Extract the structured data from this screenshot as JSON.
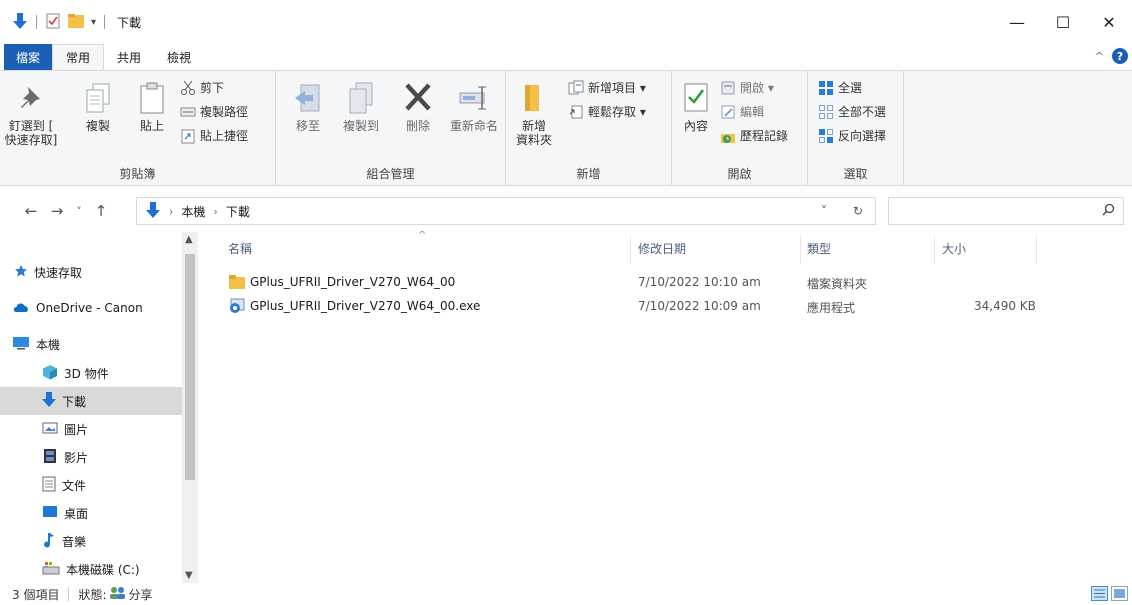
{
  "title_bar": {
    "title": "下載",
    "minimize": "—",
    "maximize": "☐",
    "close": "✕"
  },
  "tabs": {
    "file": "檔案",
    "home": "常用",
    "share": "共用",
    "view": "檢視",
    "collapse": "^",
    "help": "?"
  },
  "ribbon": {
    "clipboard": {
      "label": "剪貼簿",
      "pin_line1": "釘選到 [",
      "pin_line2": "快速存取]",
      "copy": "複製",
      "paste": "貼上",
      "cut": "剪下",
      "copy_path": "複製路徑",
      "paste_shortcut": "貼上捷徑"
    },
    "organize": {
      "label": "組合管理",
      "move_to": "移至",
      "copy_to": "複製到",
      "delete": "刪除",
      "rename": "重新命名"
    },
    "new": {
      "label": "新增",
      "new_folder_line1": "新增",
      "new_folder_line2": "資料夾",
      "new_item": "新增項目 ▾",
      "easy_access": "輕鬆存取 ▾"
    },
    "open": {
      "label": "開啟",
      "properties": "內容",
      "open": "開啟 ▾",
      "edit": "編輯",
      "history": "歷程記錄"
    },
    "select": {
      "label": "選取",
      "select_all": "全選",
      "select_none": "全部不選",
      "invert": "反向選擇"
    }
  },
  "address": {
    "back": "←",
    "forward": "→",
    "recent": "˅",
    "up": "↑",
    "crumbs": [
      "本機",
      "下載"
    ],
    "crumb_sep": "›",
    "dropdown": "˅",
    "refresh": "↻",
    "search_placeholder": ""
  },
  "sidebar": {
    "items": [
      {
        "label": "快速存取",
        "icon": "star-icon"
      },
      {
        "label": "OneDrive - Canon",
        "icon": "cloud-icon"
      },
      {
        "label": "本機",
        "icon": "pc-icon"
      },
      {
        "label": "3D 物件",
        "icon": "cube-icon"
      },
      {
        "label": "下載",
        "icon": "download-icon"
      },
      {
        "label": "圖片",
        "icon": "pictures-icon"
      },
      {
        "label": "影片",
        "icon": "videos-icon"
      },
      {
        "label": "文件",
        "icon": "documents-icon"
      },
      {
        "label": "桌面",
        "icon": "desktop-icon"
      },
      {
        "label": "音樂",
        "icon": "music-icon"
      },
      {
        "label": "本機磁碟 (C:)",
        "icon": "drive-icon"
      }
    ],
    "scroll_up": "▲",
    "scroll_down": "▼"
  },
  "filelist": {
    "columns": {
      "name": "名稱",
      "modified": "修改日期",
      "type": "類型",
      "size": "大小"
    },
    "sort_indicator": "^",
    "rows": [
      {
        "name": "GPlus_UFRII_Driver_V270_W64_00",
        "modified": "7/10/2022 10:10 am",
        "type": "檔案資料夾",
        "size": ""
      },
      {
        "name": "GPlus_UFRII_Driver_V270_W64_00.exe",
        "modified": "7/10/2022 10:09 am",
        "type": "應用程式",
        "size": "34,490 KB"
      }
    ]
  },
  "status": {
    "count": "3 個項目",
    "state_label": "狀態:",
    "shared": "分享"
  },
  "colors": {
    "accent": "#1a5fb4",
    "folder": "#f3c04a",
    "ribbon_bg": "#f5f6f7"
  }
}
